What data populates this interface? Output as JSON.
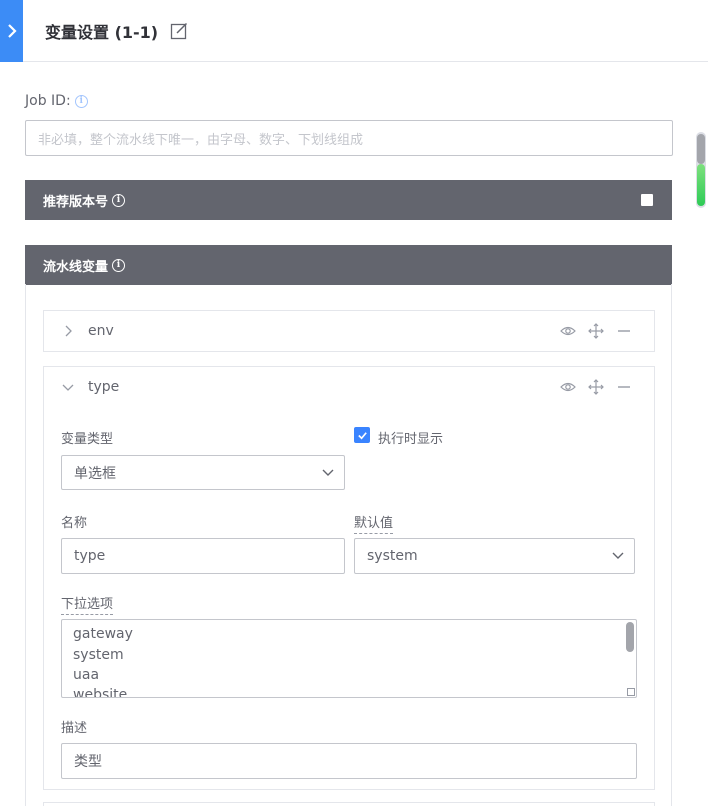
{
  "header": {
    "title": "变量设置 (1-1)"
  },
  "job_id": {
    "label": "Job ID:",
    "placeholder": "非必填，整个流水线下唯一，由字母、数字、下划线组成"
  },
  "recommend_version": {
    "label": "推荐版本号",
    "checked": false
  },
  "pipeline_vars": {
    "label": "流水线变量",
    "items": [
      {
        "name": "env",
        "expanded": false
      },
      {
        "name": "type",
        "expanded": true,
        "var_type_label": "变量类型",
        "var_type_value": "单选框",
        "show_on_run_label": "执行时显示",
        "show_on_run_checked": true,
        "name_label": "名称",
        "name_value": "type",
        "default_label": "默认值",
        "default_value": "system",
        "options_label": "下拉选项",
        "options": [
          "gateway",
          "system",
          "uaa",
          "website"
        ],
        "desc_label": "描述",
        "desc_value": "类型"
      }
    ]
  },
  "colors": {
    "accent": "#3a84ff",
    "tab_blue": "#3c8cf6",
    "section_bar": "#63656e",
    "border": "#c4c6cc"
  },
  "icons": {
    "collapse": "chevron-right-icon",
    "edit": "edit-icon",
    "info": "info-icon",
    "expand": "chevron-right-icon",
    "collapse_item": "chevron-down-icon",
    "view": "eye-icon",
    "move": "move-icon",
    "remove": "minus-icon"
  }
}
